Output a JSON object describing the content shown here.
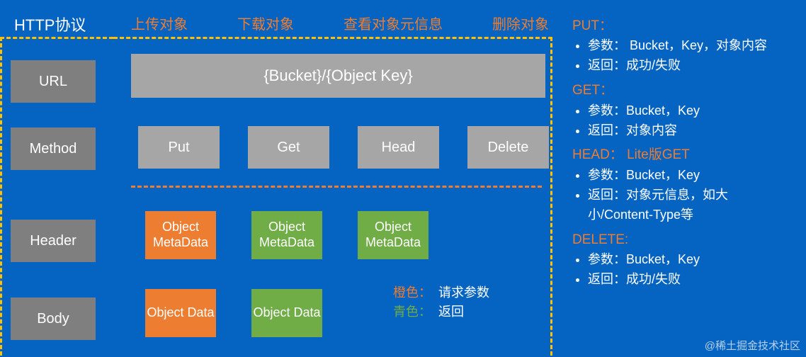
{
  "title": "HTTP协议",
  "columns": [
    "上传对象",
    "下载对象",
    "查看对象元信息",
    "删除对象"
  ],
  "rows": {
    "url": "URL",
    "method": "Method",
    "header": "Header",
    "body": "Body"
  },
  "url_template": "{Bucket}/{Object Key}",
  "methods": [
    "Put",
    "Get",
    "Head",
    "Delete"
  ],
  "meta_cells": [
    {
      "text": "Object MetaData",
      "cls": "orange"
    },
    {
      "text": "Object MetaData",
      "cls": "green"
    },
    {
      "text": "Object MetaData",
      "cls": "green"
    }
  ],
  "body_cells": [
    {
      "text": "Object Data",
      "cls": "orange"
    },
    {
      "text": "Object Data",
      "cls": "green"
    }
  ],
  "legend": {
    "orange_label": "橙色：",
    "orange_val": "请求参数",
    "green_label": "青色：",
    "green_val": "返回"
  },
  "right": [
    {
      "hd": "PUT：",
      "items": [
        "参数： Bucket，Key，对象内容",
        "返回：成功/失败"
      ]
    },
    {
      "hd": "GET：",
      "items": [
        "参数：Bucket，Key",
        "返回：对象内容"
      ]
    },
    {
      "hd": "HEAD： Lite版GET",
      "items": [
        "参数：Bucket，Key",
        "返回：对象元信息，如大小/Content-Type等"
      ]
    },
    {
      "hd": "DELETE:",
      "items": [
        "参数：Bucket，Key",
        "返回：成功/失败"
      ]
    }
  ],
  "watermark": "@稀土掘金技术社区"
}
